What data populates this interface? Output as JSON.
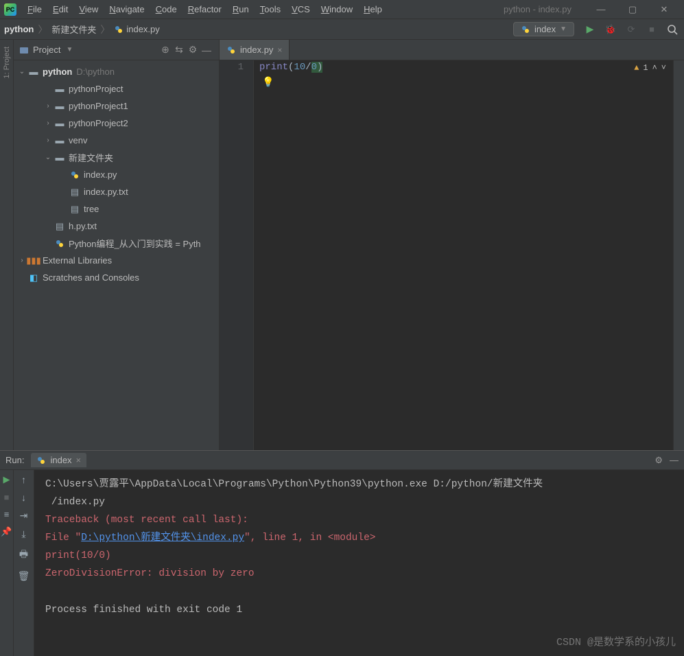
{
  "title": "python - index.py",
  "menu": [
    "File",
    "Edit",
    "View",
    "Navigate",
    "Code",
    "Refactor",
    "Run",
    "Tools",
    "VCS",
    "Window",
    "Help"
  ],
  "breadcrumb": {
    "root": "python",
    "folder": "新建文件夹",
    "file": "index.py"
  },
  "runconfig": {
    "label": "index"
  },
  "project_panel": {
    "title": "Project",
    "root": {
      "name": "python",
      "path": "D:\\python"
    },
    "children": [
      {
        "name": "pythonProject",
        "type": "folder",
        "depth": 1,
        "twisty": ""
      },
      {
        "name": "pythonProject1",
        "type": "folder",
        "depth": 1,
        "twisty": "›"
      },
      {
        "name": "pythonProject2",
        "type": "folder",
        "depth": 1,
        "twisty": "›"
      },
      {
        "name": "venv",
        "type": "folder",
        "depth": 1,
        "twisty": "›"
      },
      {
        "name": "新建文件夹",
        "type": "folder",
        "depth": 1,
        "twisty": "⌄"
      },
      {
        "name": "index.py",
        "type": "py",
        "depth": 2,
        "twisty": ""
      },
      {
        "name": "index.py.txt",
        "type": "txt",
        "depth": 2,
        "twisty": ""
      },
      {
        "name": "tree",
        "type": "txt",
        "depth": 2,
        "twisty": ""
      },
      {
        "name": "h.py.txt",
        "type": "txt",
        "depth": 1,
        "twisty": ""
      },
      {
        "name": "Python编程_从入门到实践 = Pyth",
        "type": "py",
        "depth": 1,
        "twisty": ""
      }
    ],
    "ext_lib": "External Libraries",
    "scratches": "Scratches and Consoles"
  },
  "editor": {
    "tab_label": "index.py",
    "linenum": "1",
    "code": {
      "fn": "print",
      "lp": "(",
      "n1": "10",
      "slash": "/",
      "n2": "0",
      "rp": ")"
    },
    "warn_count": "1"
  },
  "run": {
    "label": "Run:",
    "tab": "index",
    "console": {
      "cmd": "C:\\Users\\贾露平\\AppData\\Local\\Programs\\Python\\Python39\\python.exe D:/python/新建文件夹",
      "cmd2": "/index.py",
      "tb": "Traceback (most recent call last):",
      "file_pre": "  File \"",
      "file_link": "D:\\python\\新建文件夹\\index.py",
      "file_post": "\", line 1, in <module>",
      "errline": "    print(10/0)",
      "err": "ZeroDivisionError: division by zero",
      "exit": "Process finished with exit code 1"
    }
  },
  "watermark": "CSDN @是数学系的小孩儿"
}
